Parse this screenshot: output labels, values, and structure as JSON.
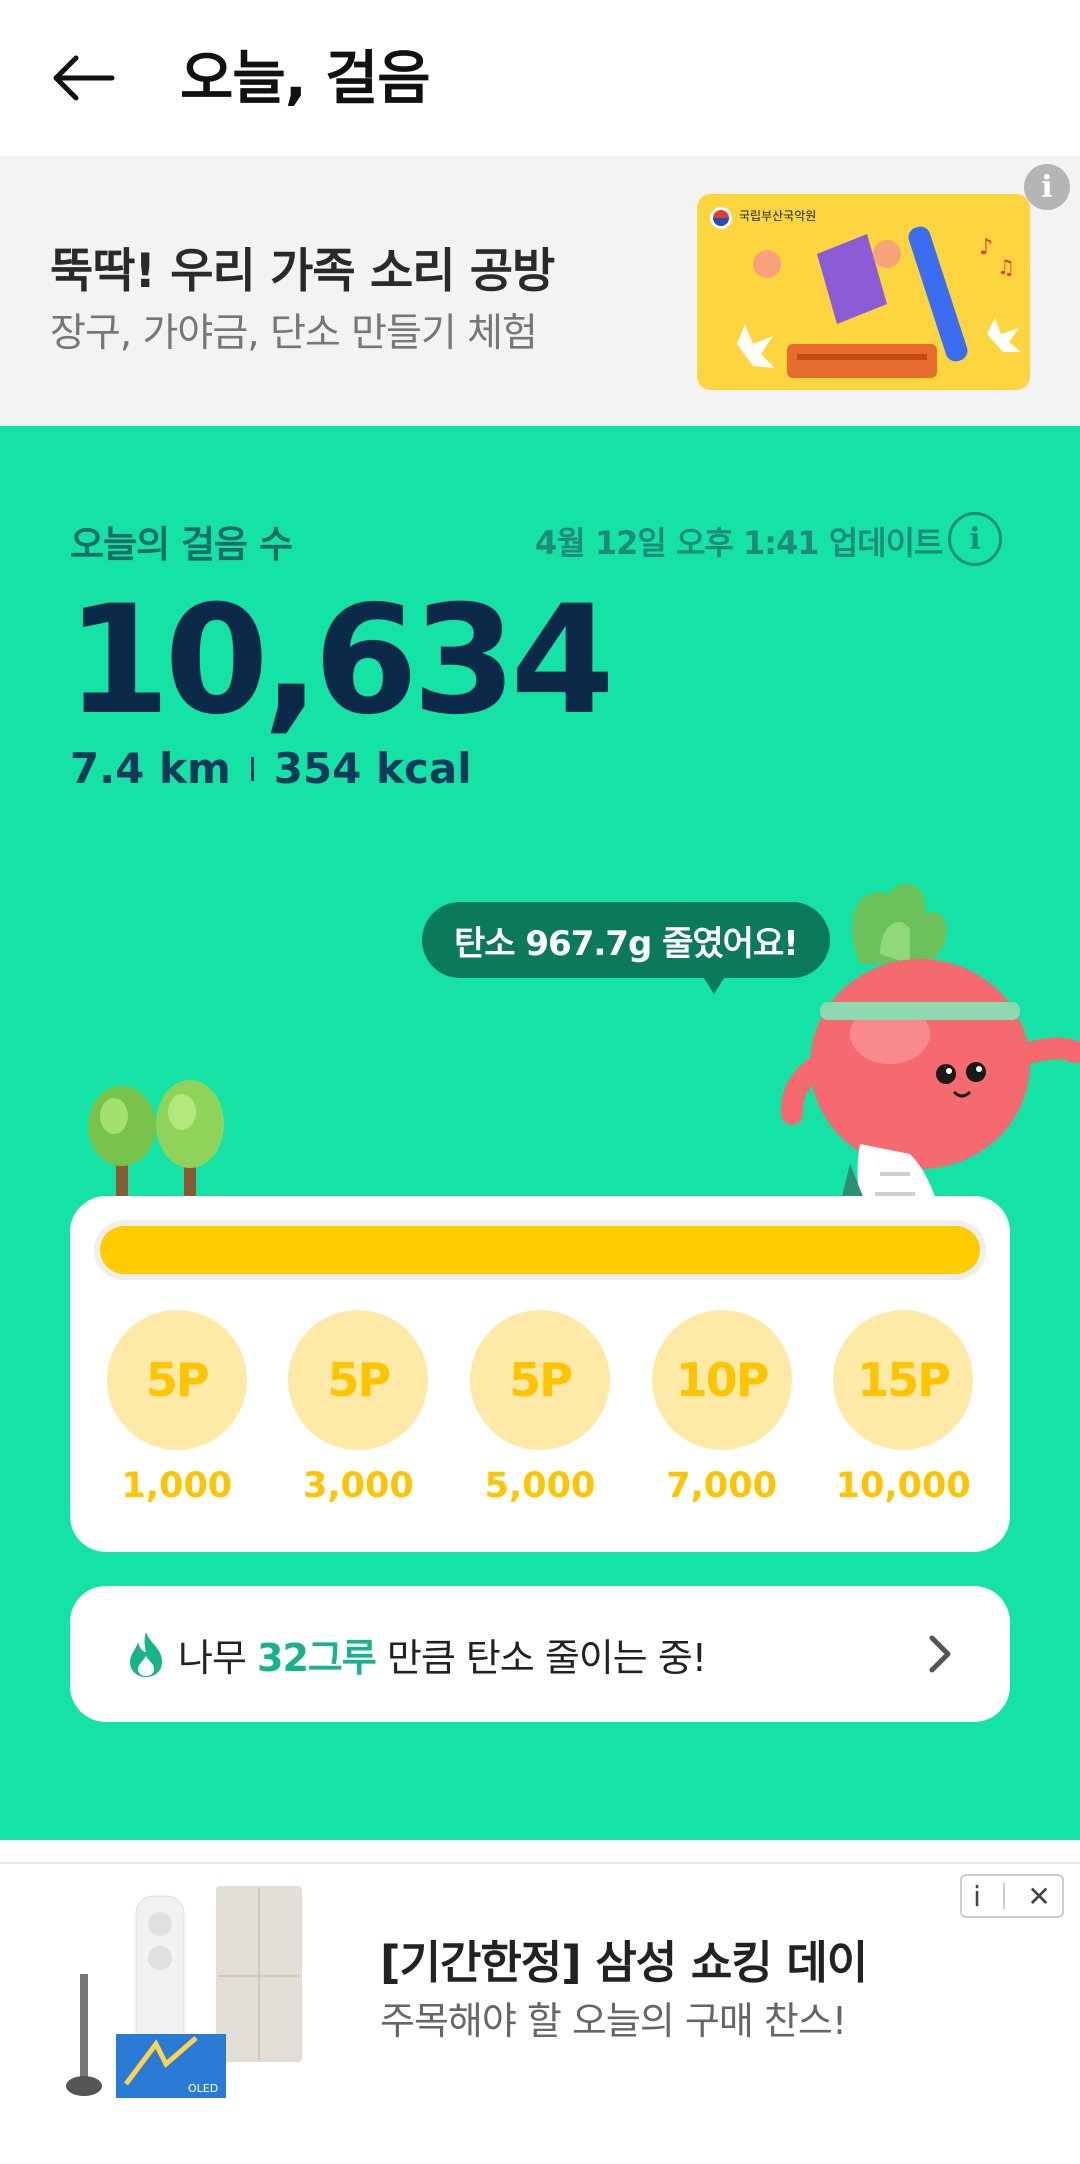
{
  "header": {
    "title": "오늘, 걸음",
    "back_icon": "arrow-left-icon"
  },
  "top_banner": {
    "title": "뚝딱! 우리 가족 소리 공방",
    "subtitle": "장구, 가야금, 단소 만들기 체험",
    "image_org_text": "국립부산국악원",
    "info_icon": "info-icon"
  },
  "steps": {
    "label": "오늘의 걸음 수",
    "updated": "4월 12일 오후 1:41 업데이트",
    "count": "10,634",
    "distance": "7.4 km",
    "calories": "354 kcal"
  },
  "carbon_bubble": "탄소 967.7g 줄였어요!",
  "progress": {
    "fill_fraction": 1.0,
    "fill_color": "#ffcc00",
    "milestones": [
      {
        "points": "5P",
        "steps": "1,000"
      },
      {
        "points": "5P",
        "steps": "3,000"
      },
      {
        "points": "5P",
        "steps": "5,000"
      },
      {
        "points": "10P",
        "steps": "7,000"
      },
      {
        "points": "15P",
        "steps": "10,000"
      }
    ]
  },
  "carbon_card": {
    "prefix": "나무 ",
    "highlight": "32그루",
    "suffix": " 만큼 탄소 줄이는 중!",
    "icon": "flame-icon"
  },
  "bottom_ad": {
    "title": "[기간한정] 삼성 쇼킹 데이",
    "subtitle": "주목해야 할 오늘의 구매 찬스!",
    "image_badge": "OLED",
    "info_label": "i",
    "close_label": "✕"
  },
  "colors": {
    "main_bg": "#15e3a6",
    "count_color": "#0b2a4a",
    "milestone_color": "#ffc400"
  }
}
